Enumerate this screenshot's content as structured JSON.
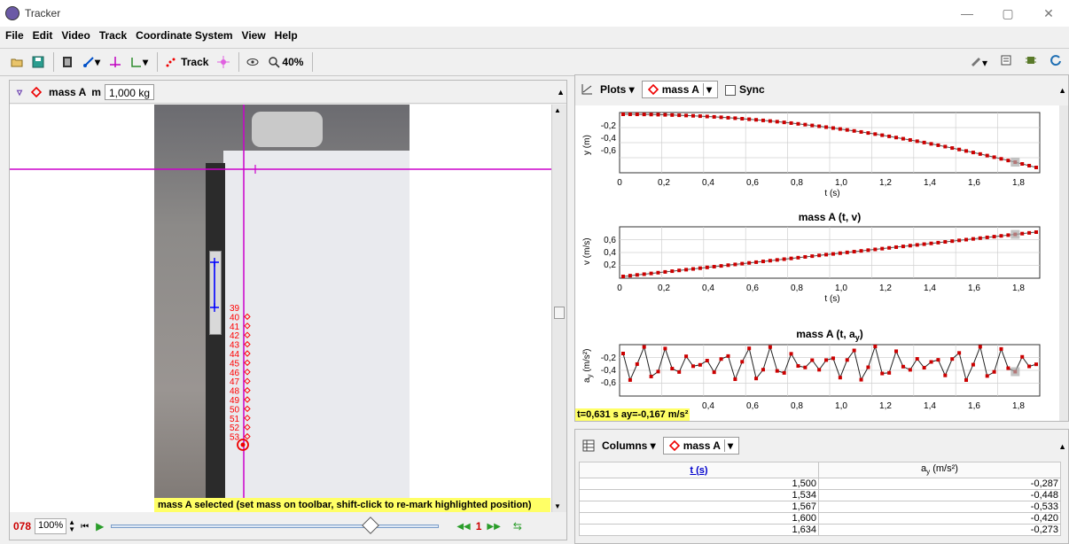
{
  "window": {
    "title": "Tracker",
    "minimize": "—",
    "maximize": "▢",
    "close": "✕"
  },
  "menu": [
    "File",
    "Edit",
    "Video",
    "Track",
    "Coordinate System",
    "View",
    "Help"
  ],
  "toolbar": {
    "track_label": "Track",
    "zoom_label": "40%"
  },
  "track_bar": {
    "track_name": "mass A",
    "mass_label": "m",
    "mass_value": "1,000 kg"
  },
  "video": {
    "frame_labels": [
      "39",
      "40",
      "41",
      "42",
      "43",
      "44",
      "45",
      "46",
      "47",
      "48",
      "49",
      "50",
      "51",
      "52",
      "53"
    ],
    "caption": "mass A selected (set mass on toolbar, shift-click to re-mark highlighted position)",
    "colors": {
      "axis": "#cc00cc",
      "track": "#ff0000",
      "calibration": "#0000ff"
    }
  },
  "player": {
    "frame": "078",
    "rate": "100%",
    "step": "1"
  },
  "plots_bar": {
    "plots_label": "Plots",
    "track_name": "mass A",
    "sync_label": "Sync"
  },
  "plots": [
    {
      "title": "",
      "ylabel": "y (m)",
      "xlabel": "t (s)",
      "yticks": [
        "-0,2",
        "-0,4",
        "-0,6"
      ],
      "xticks": [
        "0",
        "0,2",
        "0,4",
        "0,6",
        "0,8",
        "1,0",
        "1,2",
        "1,4",
        "1,6",
        "1,8"
      ]
    },
    {
      "title": "mass A (t, v)",
      "ylabel": "v (m/s)",
      "xlabel": "t (s)",
      "yticks": [
        "0,6",
        "0,4",
        "0,2"
      ],
      "xticks": [
        "0",
        "0,2",
        "0,4",
        "0,6",
        "0,8",
        "1,0",
        "1,2",
        "1,4",
        "1,6",
        "1,8"
      ]
    },
    {
      "title": "mass A (t, a",
      "title_sub": "y",
      "title_end": ")",
      "ylabel": "a",
      "ylabel_sub": "y",
      "ylabel_unit": " (m/s²)",
      "yticks": [
        "-0,2",
        "-0,4",
        "-0,6"
      ],
      "xticks": [
        "0,4",
        "0,6",
        "0,8",
        "1,0",
        "1,2",
        "1,4",
        "1,6",
        "1,8"
      ],
      "readout": "t=0,631 s  ay=-0,167 m/s²"
    }
  ],
  "table_bar": {
    "columns_label": "Columns",
    "track_name": "mass A"
  },
  "table": {
    "headers": [
      "t (s)",
      "a",
      "y",
      " (m/s²)"
    ],
    "rows": [
      [
        "1,500",
        "-0,287"
      ],
      [
        "1,534",
        "-0,448"
      ],
      [
        "1,567",
        "-0,533"
      ],
      [
        "1,600",
        "-0,420"
      ],
      [
        "1,634",
        "-0,273"
      ]
    ]
  }
}
